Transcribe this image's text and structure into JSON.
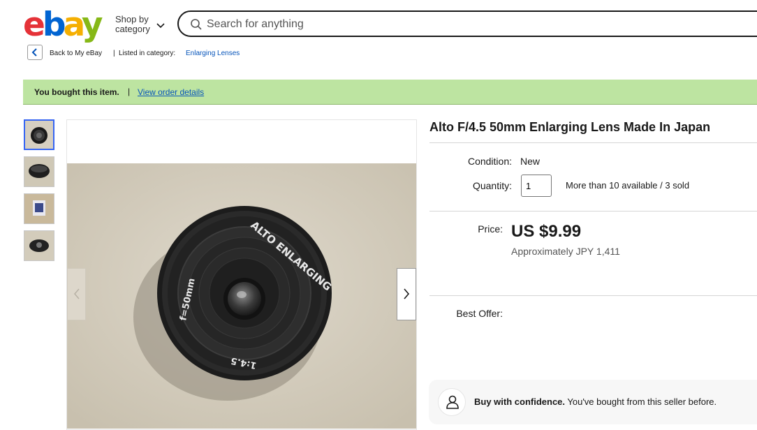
{
  "header": {
    "logo": {
      "e": "e",
      "b": "b",
      "a": "a",
      "y": "y"
    },
    "shop_by_line1": "Shop by",
    "shop_by_line2": "category",
    "search_placeholder": "Search for anything"
  },
  "breadcrumb": {
    "back": "Back to My eBay",
    "separator": "|",
    "listed_in": "Listed in category:",
    "category": "Enlarging Lenses"
  },
  "banner": {
    "text": "You bought this item.",
    "separator": "|",
    "link": "View order details"
  },
  "listing": {
    "title": "Alto F/4.5 50mm Enlarging Lens Made In Japan",
    "condition_label": "Condition:",
    "condition_value": "New",
    "quantity_label": "Quantity:",
    "quantity_value": "1",
    "availability": "More than 10 available / 3 sold",
    "price_label": "Price:",
    "price": "US $9.99",
    "approx": "Approximately JPY 1,411",
    "best_offer_label": "Best Offer:"
  },
  "lens_text": {
    "brand": "ALTO ENLARGING",
    "focal": "f=50mm",
    "aperture": "1:4.5"
  },
  "confidence": {
    "bold": "Buy with confidence.",
    "rest": " You've bought from this seller before."
  },
  "colors": {
    "banner_bg": "#bde4a1",
    "link": "#0654ba",
    "selected_thumb": "#3665f3"
  }
}
